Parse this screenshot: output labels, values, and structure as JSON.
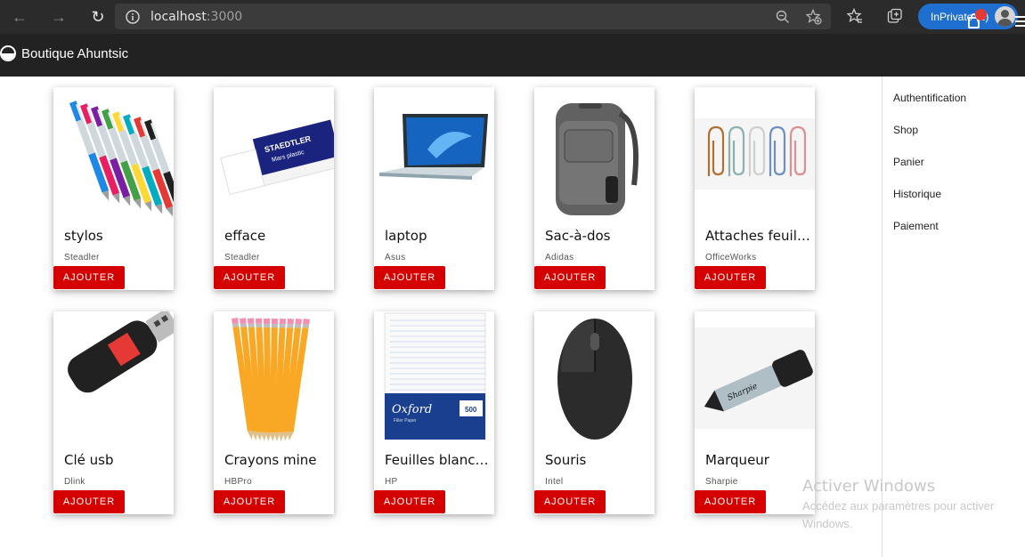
{
  "browser": {
    "url_host": "localhost",
    "url_port": ":3000",
    "inprivate_label": "InPrivate (2)"
  },
  "app": {
    "brand": "Boutique Ahuntsic",
    "cart_badge_color": "#e53935",
    "accent": "#d50000"
  },
  "products": [
    {
      "title": "stylos",
      "brand": "Steadler",
      "button": "AJOUTER",
      "image": "pens"
    },
    {
      "title": "efface",
      "brand": "Steadler",
      "button": "AJOUTER",
      "image": "eraser"
    },
    {
      "title": "laptop",
      "brand": "Asus",
      "button": "AJOUTER",
      "image": "laptop"
    },
    {
      "title": "Sac-à-dos",
      "brand": "Adidas",
      "button": "AJOUTER",
      "image": "backpack"
    },
    {
      "title": "Attaches feuilles",
      "brand": "OfficeWorks",
      "button": "AJOUTER",
      "image": "paperclips"
    },
    {
      "title": "Clé usb",
      "brand": "Dlink",
      "button": "AJOUTER",
      "image": "usb"
    },
    {
      "title": "Crayons mine",
      "brand": "HBPro",
      "button": "AJOUTER",
      "image": "pencils"
    },
    {
      "title": "Feuilles blanches",
      "brand": "HP",
      "button": "AJOUTER",
      "image": "paper"
    },
    {
      "title": "Souris",
      "brand": "Intel",
      "button": "AJOUTER",
      "image": "mouse"
    },
    {
      "title": "Marqueur",
      "brand": "Sharpie",
      "button": "AJOUTER",
      "image": "marker"
    }
  ],
  "side_menu": [
    "Authentification",
    "Shop",
    "Panier",
    "Historique",
    "Paiement"
  ],
  "watermark": {
    "title": "Activer Windows",
    "subtitle": "Accédez aux paramètres pour activer Windows."
  },
  "product_images": {
    "eraser_brand": "STAEDTLER",
    "eraser_model": "Mars plastic",
    "paper_brand": "Oxford",
    "paper_sub": "Filler Paper",
    "paper_count": "500",
    "marker_brand": "Sharpie"
  }
}
